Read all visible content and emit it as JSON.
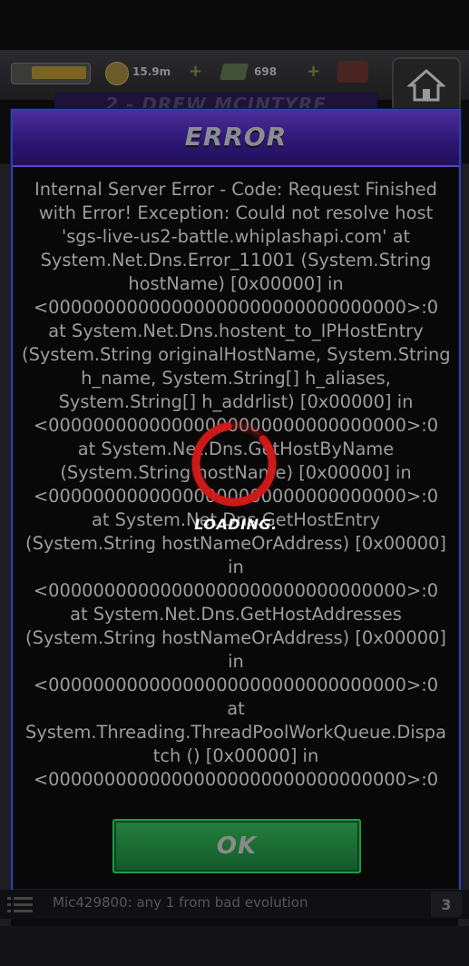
{
  "hud": {
    "coins": "15.9m",
    "cash": "698",
    "behind_title": "2 - DREW MCINTYRE"
  },
  "dialog": {
    "title": "ERROR",
    "message_lines": [
      "Internal Server Error - Code: Request Finished",
      "with Error! Exception: Could not resolve host",
      "'sgs-live-us2-battle.whiplashapi.com'  at",
      "System.Net.Dns.Error_11001 (System.String",
      "hostName) [0x00000] in",
      "<00000000000000000000000000000000>:0",
      "at System.Net.Dns.hostent_to_IPHostEntry",
      "(System.String originalHostName, System.String",
      "h_name, System.String[] h_aliases,",
      "System.String[] h_addrlist) [0x00000] in",
      "<00000000000000000000000000000000>:0",
      "at System.Net.Dns.GetHostByName",
      "(System.String hostName) [0x00000] in",
      "<00000000000000000000000000000000>:0",
      "at System.Net.Dns.GetHostEntry",
      "(System.String hostNameOrAddress) [0x00000]",
      "in",
      "<00000000000000000000000000000000>:0",
      "at System.Net.Dns.GetHostAddresses",
      "(System.String hostNameOrAddress) [0x00000]",
      "in",
      "<00000000000000000000000000000000>:0",
      "at",
      "System.Threading.ThreadPoolWorkQueue.Dispa",
      "tch () [0x00000] in",
      "<00000000000000000000000000000000>:0"
    ],
    "ok_label": "OK"
  },
  "loading": {
    "label": "LOADING."
  },
  "chat": {
    "message": "Mic429800: any 1 from bad evolution",
    "count": "3"
  },
  "colors": {
    "header_purple": "#2c1670",
    "ok_green": "#1c7636",
    "spinner_red": "#d11a1a"
  }
}
